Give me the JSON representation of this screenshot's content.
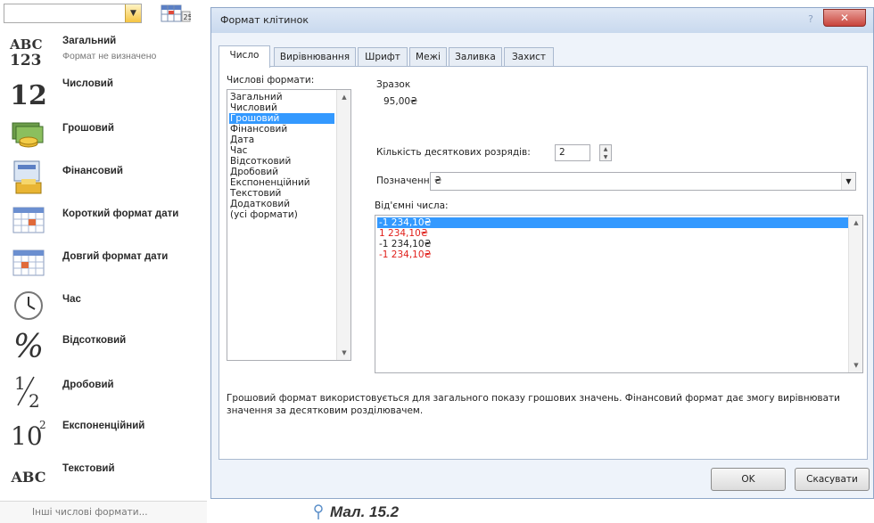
{
  "ribbon": {
    "combo_value": "",
    "format_items": [
      {
        "icon": "abc-123",
        "label": "Загальний",
        "sub": "Формат не визначено"
      },
      {
        "icon": "number-12",
        "label": "Числовий"
      },
      {
        "icon": "currency-coins",
        "label": "Грошовий"
      },
      {
        "icon": "accounting-calculator",
        "label": "Фінансовий"
      },
      {
        "icon": "calendar-short",
        "label": "Короткий формат дати"
      },
      {
        "icon": "calendar-long",
        "label": "Довгий формат дати"
      },
      {
        "icon": "clock",
        "label": "Час"
      },
      {
        "icon": "percent",
        "label": "Відсотковий"
      },
      {
        "icon": "fraction",
        "label": "Дробовий"
      },
      {
        "icon": "exponent",
        "label": "Експоненційний"
      },
      {
        "icon": "abc-text",
        "label": "Текстовий"
      }
    ],
    "more_formats": "Інші числові формати..."
  },
  "dialog": {
    "title": "Формат клітинок",
    "close": "✕",
    "tabs": [
      "Число",
      "Вирівнювання",
      "Шрифт",
      "Межі",
      "Заливка",
      "Захист"
    ],
    "active_tab": "Число",
    "categories_caption": "Числові формати:",
    "categories": [
      "Загальний",
      "Числовий",
      "Грошовий",
      "Фінансовий",
      "Дата",
      "Час",
      "Відсотковий",
      "Дробовий",
      "Експоненційний",
      "Текстовий",
      "Додатковий",
      "(усі формати)"
    ],
    "selected_category": "Грошовий",
    "sample_caption": "Зразок",
    "sample_value": "95,00₴",
    "decimals_label": "Кількість десяткових розрядів:",
    "decimals_value": "2",
    "symbol_label": "Позначення:",
    "symbol_value": "₴",
    "negative_caption": "Від'ємні числа:",
    "negative_numbers": [
      {
        "text": "-1 234,10₴",
        "color": "#ffffff",
        "selected": true
      },
      {
        "text": "1 234,10₴",
        "color": "#e0201b",
        "selected": false
      },
      {
        "text": "-1 234,10₴",
        "color": "#222222",
        "selected": false
      },
      {
        "text": "-1 234,10₴",
        "color": "#e0201b",
        "selected": false
      }
    ],
    "description": "Грошовий формат використовується для загального показу грошових значень. Фінансовий формат дає змогу вирівнювати значення за десятковим розділювачем.",
    "ok": "OK",
    "cancel": "Скасувати"
  },
  "figure_caption": "Мал. 15.2",
  "colors": {
    "selection": "#3399ff",
    "negative_red": "#e0201b",
    "close_button": "#c8433b"
  }
}
